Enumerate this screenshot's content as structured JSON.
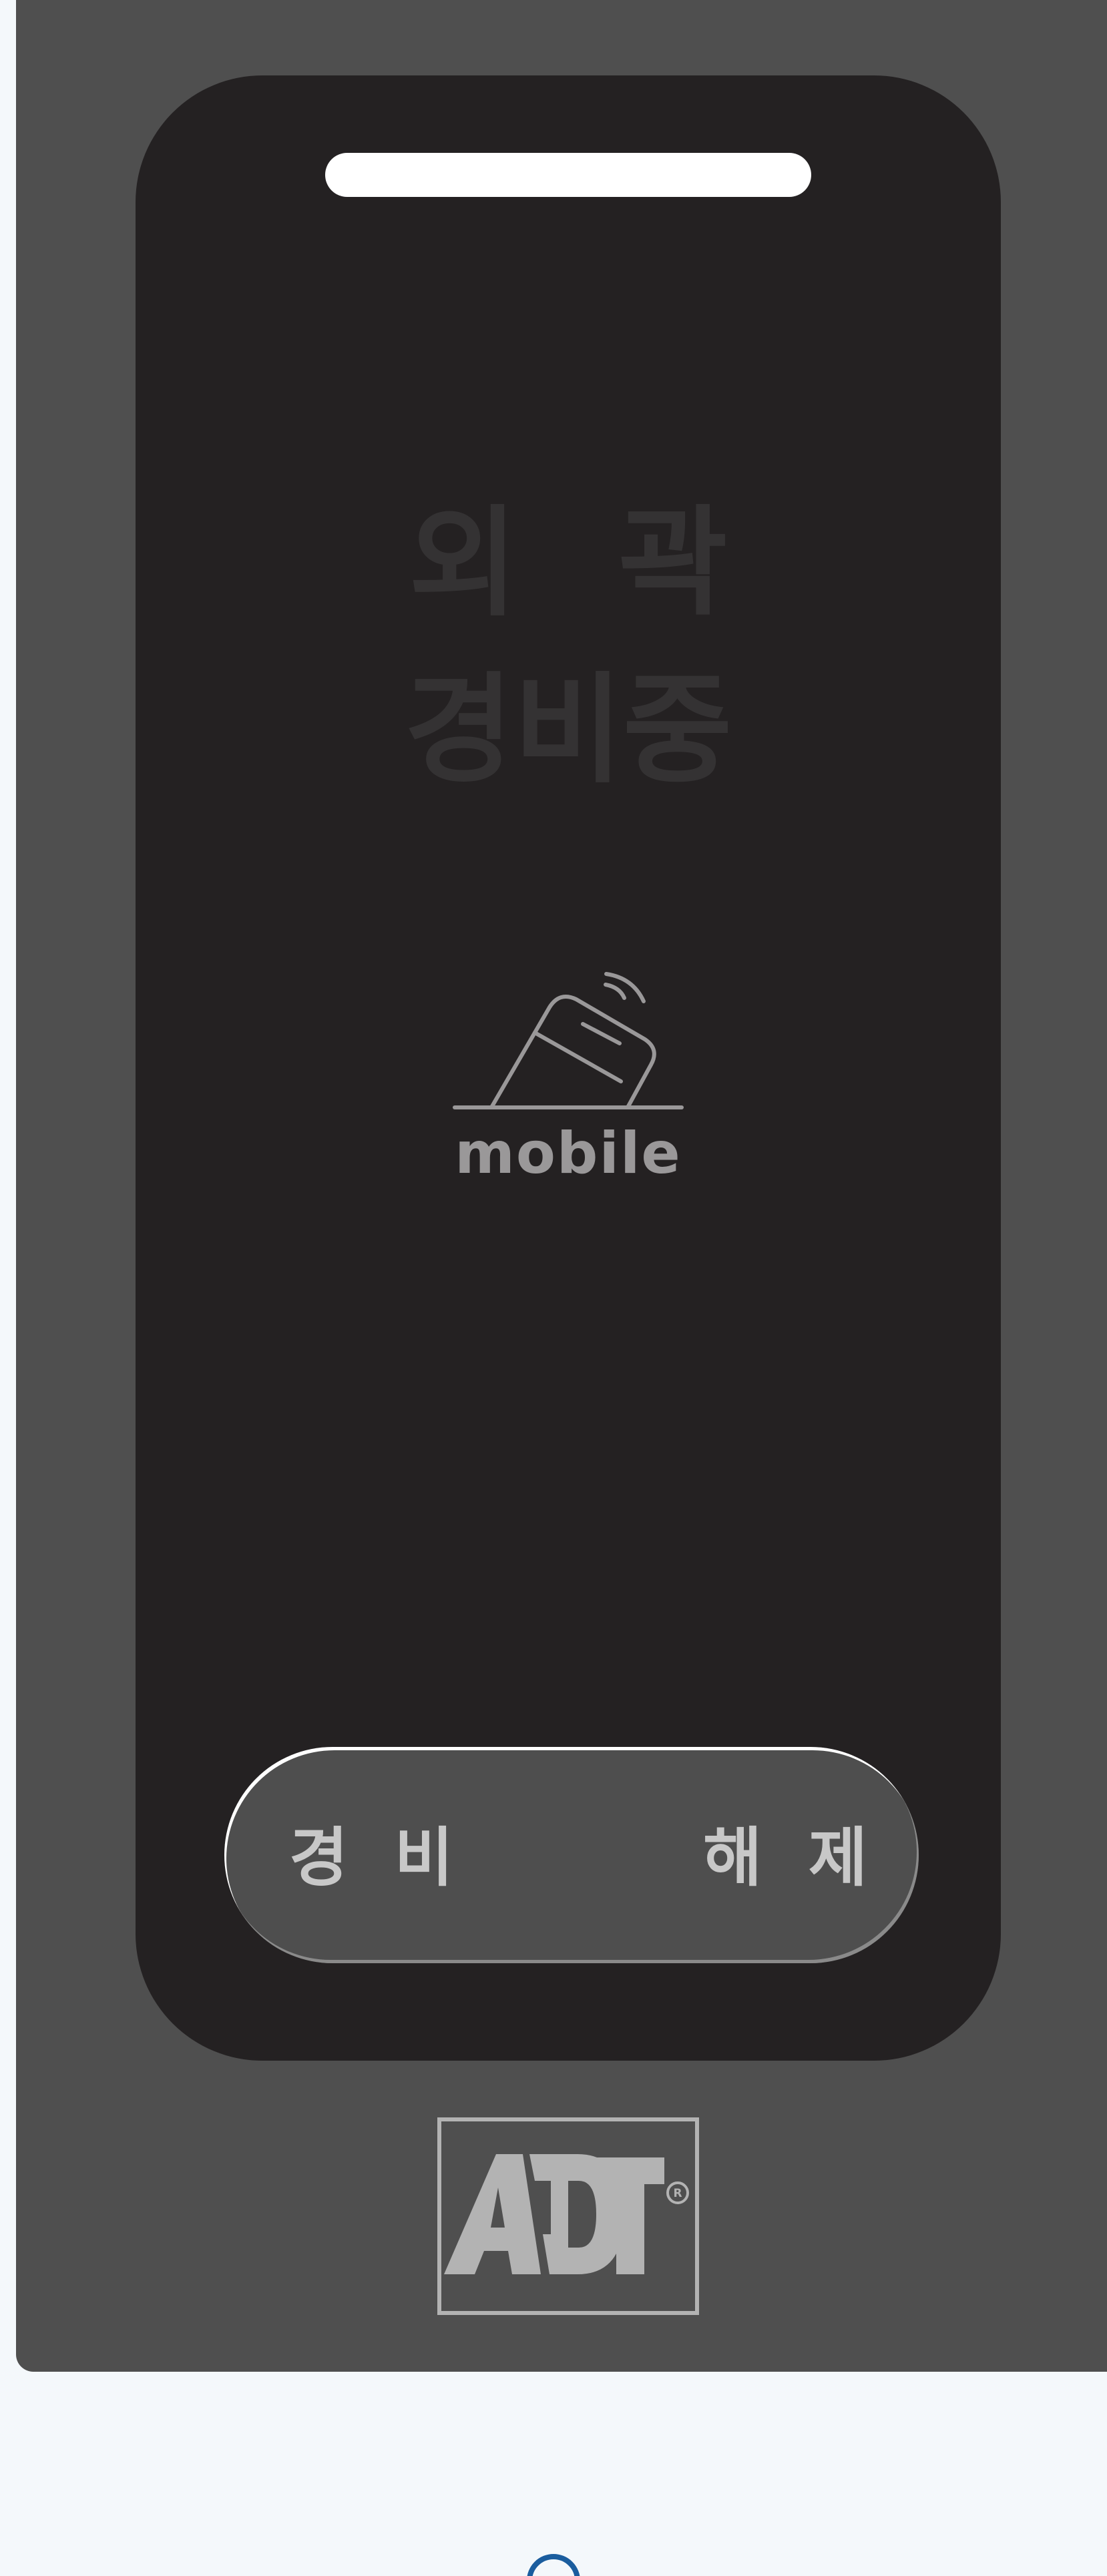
{
  "status": {
    "line1": "외 곽",
    "line2": "경비중"
  },
  "mode_badge": {
    "icon": "mobile-tilt-icon",
    "label": "mobile"
  },
  "toggle": {
    "arm_label": "경 비",
    "disarm_label": "해 제"
  },
  "brand": {
    "logo_text": "ADT"
  },
  "colors": {
    "panel": "#4f4f4f",
    "screen": "#242122",
    "page_bg": "#f4f8fb",
    "accent_blue": "#1a5d9e"
  }
}
